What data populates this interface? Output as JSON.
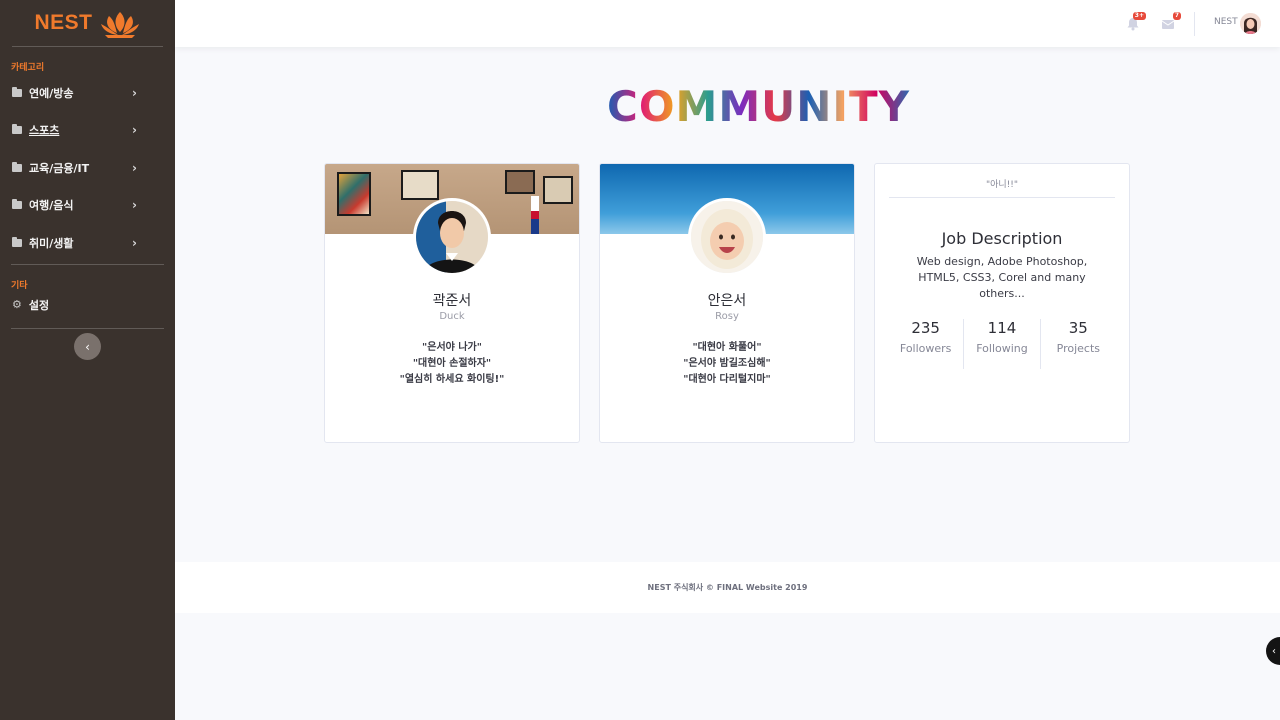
{
  "brand": {
    "name": "NEST"
  },
  "sidebar": {
    "category_heading": "카테고리",
    "items": [
      {
        "label": "연예/방송"
      },
      {
        "label": "스포츠"
      },
      {
        "label": "교육/금융/IT"
      },
      {
        "label": "여행/음식"
      },
      {
        "label": "취미/생활"
      }
    ],
    "other_heading": "기타",
    "settings_label": "설정",
    "toggle_glyph": "‹"
  },
  "topbar": {
    "alerts_badge": "3+",
    "messages_badge": "7",
    "user_name": "NEST"
  },
  "page": {
    "title": "COMMUNITY"
  },
  "profiles": [
    {
      "name": "곽준서",
      "nickname": "Duck",
      "quotes": [
        "\"은서야 나가\"",
        "\"대현아 손절하자\"",
        "\"열심히 하세요 화이팅!\""
      ]
    },
    {
      "name": "안은서",
      "nickname": "Rosy",
      "quotes": [
        "\"대현아 화풀어\"",
        "\"은서야 밤길조심해\"",
        "\"대현아 다리털지마\""
      ]
    }
  ],
  "info_card": {
    "quote": "\"아니!!\"",
    "job_title": "Job Description",
    "job_desc": "Web design, Adobe Photoshop, HTML5, CSS3, Corel and many others...",
    "stats": [
      {
        "value": "235",
        "label": "Followers"
      },
      {
        "value": "114",
        "label": "Following"
      },
      {
        "value": "35",
        "label": "Projects"
      }
    ]
  },
  "footer": {
    "text": "NEST 주식회사 © FINAL Website 2019"
  },
  "colors": {
    "accent": "#f07a2c",
    "sidebar_bg": "#3a322d",
    "page_bg": "#f8f9fc"
  }
}
